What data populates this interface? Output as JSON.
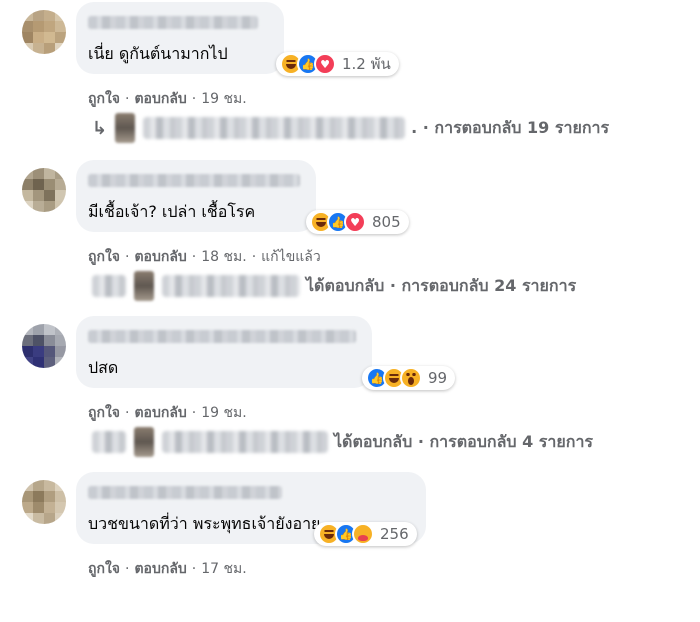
{
  "comments": [
    {
      "text": "เนี่ย ดูกันต์นามากไป",
      "reactions": [
        "haha",
        "like",
        "love"
      ],
      "count": "1.2 พัน",
      "like": "ถูกใจ",
      "reply": "ตอบกลับ",
      "time": "19 ชม.",
      "edited": "",
      "replies_text": ". · การตอบกลับ 19 รายการ"
    },
    {
      "text": "มีเชื้อเจ้า? เปล่า เชื้อโรค",
      "reactions": [
        "haha",
        "like",
        "love"
      ],
      "count": "805",
      "like": "ถูกใจ",
      "reply": "ตอบกลับ",
      "time": "18 ชม.",
      "edited": "แก้ไขแล้ว",
      "replies_text": "ได้ตอบกลับ · การตอบกลับ 24 รายการ"
    },
    {
      "text": "ปสด",
      "reactions": [
        "like",
        "haha",
        "wow"
      ],
      "count": "99",
      "like": "ถูกใจ",
      "reply": "ตอบกลับ",
      "time": "19 ชม.",
      "edited": "",
      "replies_text": "ได้ตอบกลับ · การตอบกลับ 4 รายการ"
    },
    {
      "text": "บวชขนาดที่ว่า พระพุทธเจ้ายังอาย.....",
      "reactions": [
        "haha",
        "like",
        "care"
      ],
      "count": "256",
      "like": "ถูกใจ",
      "reply": "ตอบกลับ",
      "time": "17 ชม.",
      "edited": "",
      "replies_text": ""
    }
  ],
  "icons": {
    "reply_arrow": "↳",
    "haha": "haha-reaction-icon",
    "like": "like-reaction-icon",
    "love": "love-reaction-icon",
    "wow": "wow-reaction-icon",
    "care": "care-reaction-icon"
  },
  "colors": {
    "bubble": "#f0f2f5",
    "meta_text": "#65676b",
    "like_blue": "#1877f2",
    "love_red": "#f33e58",
    "emoji_yellow": "#f7b125"
  }
}
